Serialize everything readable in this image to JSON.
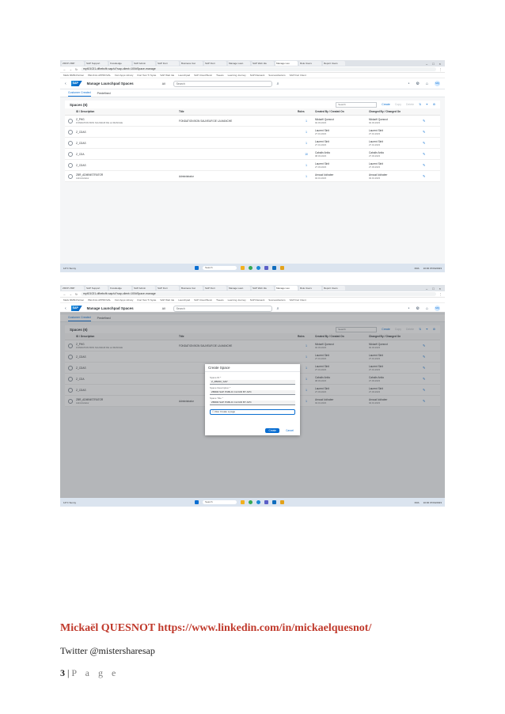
{
  "screenshots": [
    {
      "tabs": [
        "ZDFP-VMP",
        "SAP Support",
        "Knowledge",
        "SAP Admin",
        "SAP Fiori",
        "Business Cat",
        "SAP Fiori",
        "Manage Laun",
        "SAP Web Ide",
        "Manage Lau",
        "Role Users",
        "Report Users",
        "Manage"
      ],
      "url": "my401021-dfbebcfb.sap/ui?sap-client=100#Space-manage",
      "bookmarks": [
        "Mails MMM-Partner",
        "PELICAL APPROVAL",
        "Fiori Apps Library",
        "Fiori Test Tr Syste",
        "SAP Web Ide",
        "Launchpad",
        "SAP Cloud Busin",
        "Tweets",
        "Learning Journey",
        "SAP Ransack",
        "SuccessFactors",
        "SAP Fiori Client",
        "SAP Cloud Launch",
        "Manage"
      ],
      "shell": {
        "title": "Manage Launchpad Spaces",
        "scope": "All",
        "search_placeholder": "Search",
        "avatar": "MQ"
      },
      "subtabs": [
        "Customer Created",
        "Predefined"
      ],
      "table": {
        "title": "Spaces (6)",
        "search_placeholder": "Search",
        "actions": [
          "Create",
          "Copy",
          "Delete"
        ],
        "columns": [
          "ID / Description",
          "Title",
          "Roles",
          "Created By / Created On",
          "Changed By / Changed On"
        ],
        "rows": [
          {
            "id": "Z_PHG",
            "desc": "FONDATION BON SAUVEUR DE LA MANCHE",
            "title": "FONDATION BON SAUVEUR DE LA MANCHE",
            "roles": "1",
            "created_by": "Mickaël Quesnot",
            "created_on": "02.03.2023",
            "changed_by": "Mickaël Quesnot",
            "changed_on": "02.03.2023"
          },
          {
            "id": "Z_CDAS",
            "desc": "",
            "title": "",
            "roles": "1",
            "created_by": "Laurent Sinit",
            "created_on": "27.01.2023",
            "changed_by": "Laurent Sinit",
            "changed_on": "27.01.2023"
          },
          {
            "id": "Z_CDAS",
            "desc": "",
            "title": "",
            "roles": "1",
            "created_by": "Laurent Sinit",
            "created_on": "27.01.2023",
            "changed_by": "Laurent Sinit",
            "changed_on": "27.01.2023"
          },
          {
            "id": "Z_CDA",
            "desc": "",
            "title": "",
            "roles": "10",
            "created_by": "Cabalin Anita",
            "created_on": "08.03.2023",
            "changed_by": "Cabalin Anita",
            "changed_on": "27.03.2023"
          },
          {
            "id": "Z_CDAS",
            "desc": "",
            "title": "",
            "roles": "1",
            "created_by": "Laurent Sinit",
            "created_on": "27.03.2023",
            "changed_by": "Laurent Sinit",
            "changed_on": "27.03.2023"
          },
          {
            "id": "ZBR_ADMINISTRATOR",
            "desc": "Administrator",
            "title": "Administrator",
            "roles": "1",
            "created_by": "Arnaud Ickhaber",
            "created_on": "04.01.2023",
            "changed_by": "Arnaud Ickhaber",
            "changed_on": "04.01.2023"
          }
        ]
      },
      "taskbar": {
        "weather": "14°C Sunny",
        "search": "Search",
        "lang": "FRA",
        "time": "10:00",
        "date": "07/04/2023"
      }
    },
    {
      "tabs": [
        "ZDFP-VMP",
        "SAP Support",
        "Knowledge",
        "SAP Admin",
        "SAP Fiori",
        "Business Cat",
        "SAP Fiori",
        "Manage Laun",
        "SAP Web Ide",
        "Manage Lau",
        "Role Users",
        "Report Users",
        "Manage"
      ],
      "url": "my401021-dfbebcfb.sap/ui?sap-client=100#Space-manage",
      "bookmarks": [
        "Mails MMM-Partner",
        "PELICAL APPROVAL",
        "Fiori Apps Library",
        "Fiori Test Tr Syste",
        "SAP Web Ide",
        "Launchpad",
        "SAP Cloud Busin",
        "Tweets",
        "Learning Journey",
        "SAP Ransack",
        "SuccessFactors",
        "SAP Fiori Client",
        "SAP Cloud Launch",
        "Manage"
      ],
      "shell": {
        "title": "Manage Launchpad Spaces",
        "scope": "All",
        "search_placeholder": "Search",
        "avatar": "MQ"
      },
      "subtabs": [
        "Customer Created",
        "Predefined"
      ],
      "table": {
        "title": "Spaces (6)",
        "search_placeholder": "Search",
        "actions": [
          "Create",
          "Copy",
          "Delete"
        ],
        "columns": [
          "ID / Description",
          "Title",
          "Roles",
          "Created By / Created On",
          "Changed By / Changed On"
        ],
        "rows": [
          {
            "id": "Z_PHG",
            "desc": "FONDATION BON SAUVEUR DE LA MANCHE",
            "title": "FONDATION BON SAUVEUR DE LA MANCHE",
            "roles": "1",
            "created_by": "Mickaël Quesnot",
            "created_on": "02.03.2023",
            "changed_by": "Mickaël Quesnot",
            "changed_on": "02.03.2023"
          },
          {
            "id": "Z_CDAS",
            "desc": "",
            "title": "",
            "roles": "1",
            "created_by": "Laurent Sinit",
            "created_on": "27.01.2023",
            "changed_by": "Laurent Sinit",
            "changed_on": "27.01.2023"
          },
          {
            "id": "Z_CDAS",
            "desc": "",
            "title": "",
            "roles": "1",
            "created_by": "Laurent Sinit",
            "created_on": "27.01.2023",
            "changed_by": "Laurent Sinit",
            "changed_on": "27.01.2023"
          },
          {
            "id": "Z_CDA",
            "desc": "",
            "title": "",
            "roles": "1",
            "created_by": "Cabalin Anita",
            "created_on": "08.03.2023",
            "changed_by": "Cabalin Anita",
            "changed_on": "27.03.2023"
          },
          {
            "id": "Z_CDAS",
            "desc": "",
            "title": "",
            "roles": "1",
            "created_by": "Laurent Sinit",
            "created_on": "27.03.2023",
            "changed_by": "Laurent Sinit",
            "changed_on": "27.03.2023"
          },
          {
            "id": "ZBR_ADMINISTRATOR",
            "desc": "Administrator",
            "title": "Administrator",
            "roles": "1",
            "created_by": "Arnaud Ickhaber",
            "created_on": "04.01.2023",
            "changed_by": "Arnaud Ickhaber",
            "changed_on": "04.01.2023"
          }
        ]
      },
      "dialog": {
        "title": "Create Space",
        "fields": [
          {
            "label": "Space ID *",
            "value": "Z_ZBR00_SAP"
          },
          {
            "label": "Space Description *",
            "value": "ZBR00 SAP PUBLIC CLOUD BY APC"
          },
          {
            "label": "Space Title *",
            "value": "ZBR00 SAP PUBLIC CLOUD BY APC"
          }
        ],
        "checkbox": "Also Create a page",
        "create": "Create",
        "cancel": "Cancel"
      },
      "taskbar": {
        "weather": "14°C Sunny",
        "search": "Search",
        "lang": "FRA",
        "time": "10:00",
        "date": "07/04/2023"
      }
    }
  ],
  "footer": {
    "author": "Mickaël QUESNOT https://www.linkedin.com/in/mickaelquesnot/",
    "twitter": "Twitter @mistersharesap",
    "page_number": "3",
    "page_sep": " | ",
    "page_word": "P a g e"
  }
}
